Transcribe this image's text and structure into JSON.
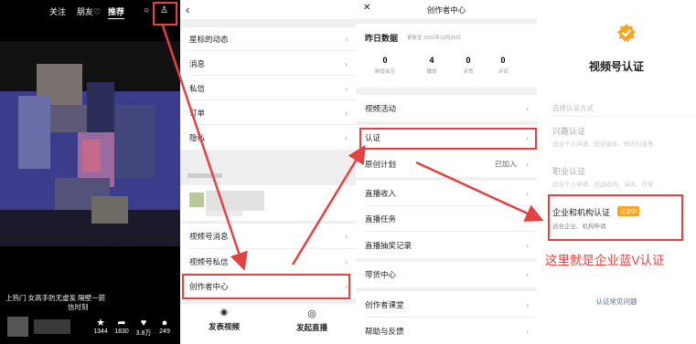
{
  "feed": {
    "tabs": [
      "关注",
      "朋友♡",
      "推荐"
    ],
    "caption_lines": [
      "上热门 女高手防无虚发 隔壁一箭",
      "信时刻"
    ],
    "stats": [
      {
        "icon": "star-icon",
        "glyph": "★",
        "value": "1344"
      },
      {
        "icon": "share-icon",
        "glyph": "➦",
        "value": "1830"
      },
      {
        "icon": "heart-icon",
        "glyph": "♥",
        "value": "3.8万"
      },
      {
        "icon": "comment-icon",
        "glyph": "●",
        "value": "249"
      }
    ]
  },
  "settings": {
    "back": "‹",
    "items": [
      {
        "label": "星标的动态"
      },
      {
        "label": "消息"
      },
      {
        "label": "私信"
      },
      {
        "label": "订单"
      },
      {
        "label": "隐私"
      }
    ],
    "channel_items": [
      {
        "label": "视频号消息"
      },
      {
        "label": "视频号私信"
      },
      {
        "label": "创作者中心"
      }
    ],
    "bottom_actions": [
      {
        "icon": "camera-icon",
        "glyph": "◉",
        "label": "发表视频"
      },
      {
        "icon": "live-icon",
        "glyph": "◎",
        "label": "发起直播"
      }
    ]
  },
  "creator": {
    "close": "✕",
    "title": "创作者中心",
    "data_title": "昨日数据",
    "data_updated": "更新至 2021年12月26日",
    "metrics": [
      {
        "value": "0",
        "label": "新增关注"
      },
      {
        "value": "4",
        "label": "播放"
      },
      {
        "value": "0",
        "label": "点赞"
      },
      {
        "value": "0",
        "label": "评论"
      }
    ],
    "menu": [
      {
        "label": "视频活动",
        "value": ""
      },
      {
        "label": "认证",
        "value": ""
      },
      {
        "label": "原创计划",
        "value": "已加入"
      },
      {
        "label": "直播收入",
        "value": ""
      },
      {
        "label": "直播任务",
        "value": ""
      },
      {
        "label": "直播抽奖记录",
        "value": ""
      },
      {
        "label": "带货中心",
        "value": ""
      },
      {
        "label": "创作者课堂",
        "value": ""
      },
      {
        "label": "帮助与反馈",
        "value": ""
      }
    ]
  },
  "verify": {
    "title": "视频号认证",
    "select_label": "选择认证方式",
    "options": [
      {
        "name": "兴趣认证",
        "desc": "适合个人申请，如自媒体、知识科普等",
        "badge": ""
      },
      {
        "name": "职业认证",
        "desc": "适合个人申请，如运动员、演员、作家",
        "badge": ""
      },
      {
        "name": "企业和机构认证",
        "desc": "适合企业、机构申请",
        "badge": "认证中"
      }
    ],
    "annotation": "这里就是企业蓝V认证",
    "faq": "认证常见问题"
  },
  "colors": {
    "annotation_red": "#e74040",
    "wechat_orange": "#f5a623",
    "link_blue": "#576b95"
  }
}
